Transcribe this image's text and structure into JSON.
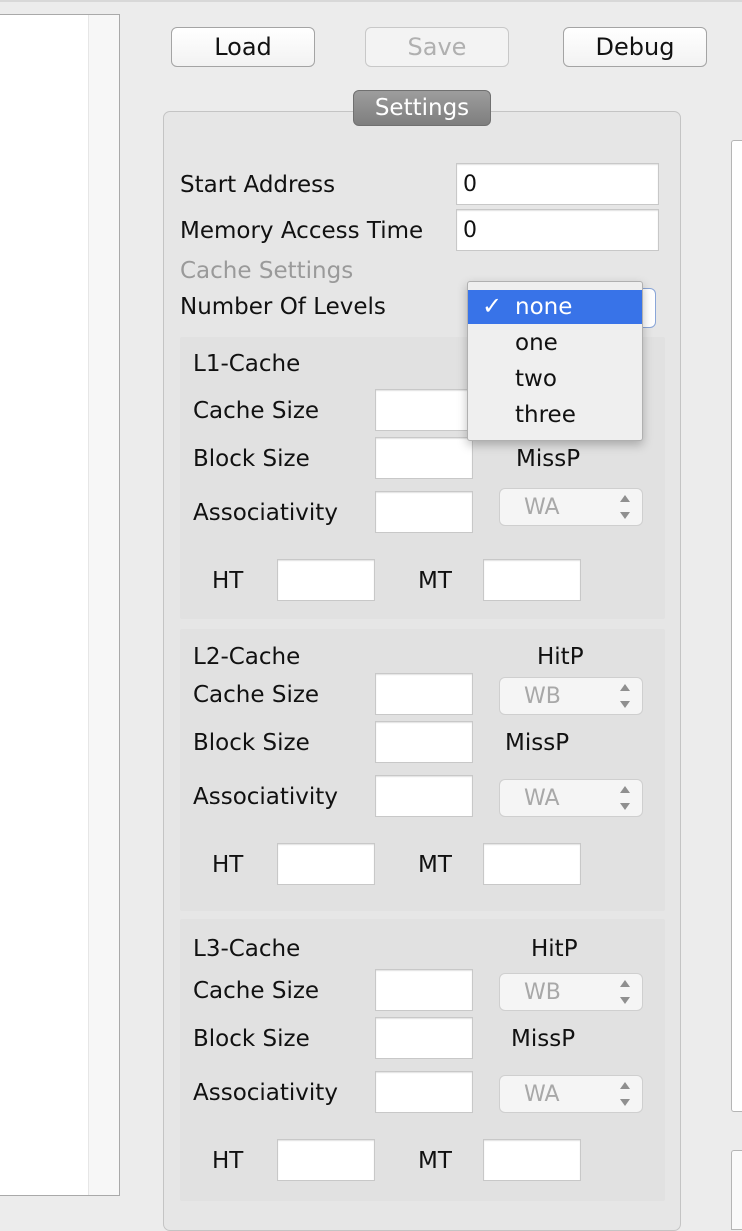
{
  "toolbar": {
    "load_label": "Load",
    "save_label": "Save",
    "debug_label": "Debug"
  },
  "settings": {
    "tab_label": "Settings",
    "start_address": {
      "label": "Start Address",
      "value": "0"
    },
    "memory_access_time": {
      "label": "Memory Access Time",
      "value": "0"
    },
    "cache_settings_label": "Cache Settings",
    "number_of_levels": {
      "label": "Number Of Levels",
      "selected": "none",
      "options": [
        "none",
        "one",
        "two",
        "three"
      ],
      "check_glyph": "✓"
    },
    "l1": {
      "title": "L1-Cache",
      "cache_size_label": "Cache Size",
      "block_size_label": "Block Size",
      "associativity_label": "Associativity",
      "missp_label": "MissP",
      "miss_policy": "WA",
      "ht_label": "HT",
      "mt_label": "MT"
    },
    "l2": {
      "title": "L2-Cache",
      "hitp_label": "HitP",
      "cache_size_label": "Cache Size",
      "hit_policy": "WB",
      "block_size_label": "Block Size",
      "missp_label": "MissP",
      "associativity_label": "Associativity",
      "miss_policy": "WA",
      "ht_label": "HT",
      "mt_label": "MT"
    },
    "l3": {
      "title": "L3-Cache",
      "hitp_label": "HitP",
      "cache_size_label": "Cache Size",
      "hit_policy": "WB",
      "block_size_label": "Block Size",
      "missp_label": "MissP",
      "associativity_label": "Associativity",
      "miss_policy": "WA",
      "ht_label": "HT",
      "mt_label": "MT"
    }
  },
  "colors": {
    "selection": "#3873e8",
    "tab": "#8a8a8a",
    "background": "#ececec"
  }
}
